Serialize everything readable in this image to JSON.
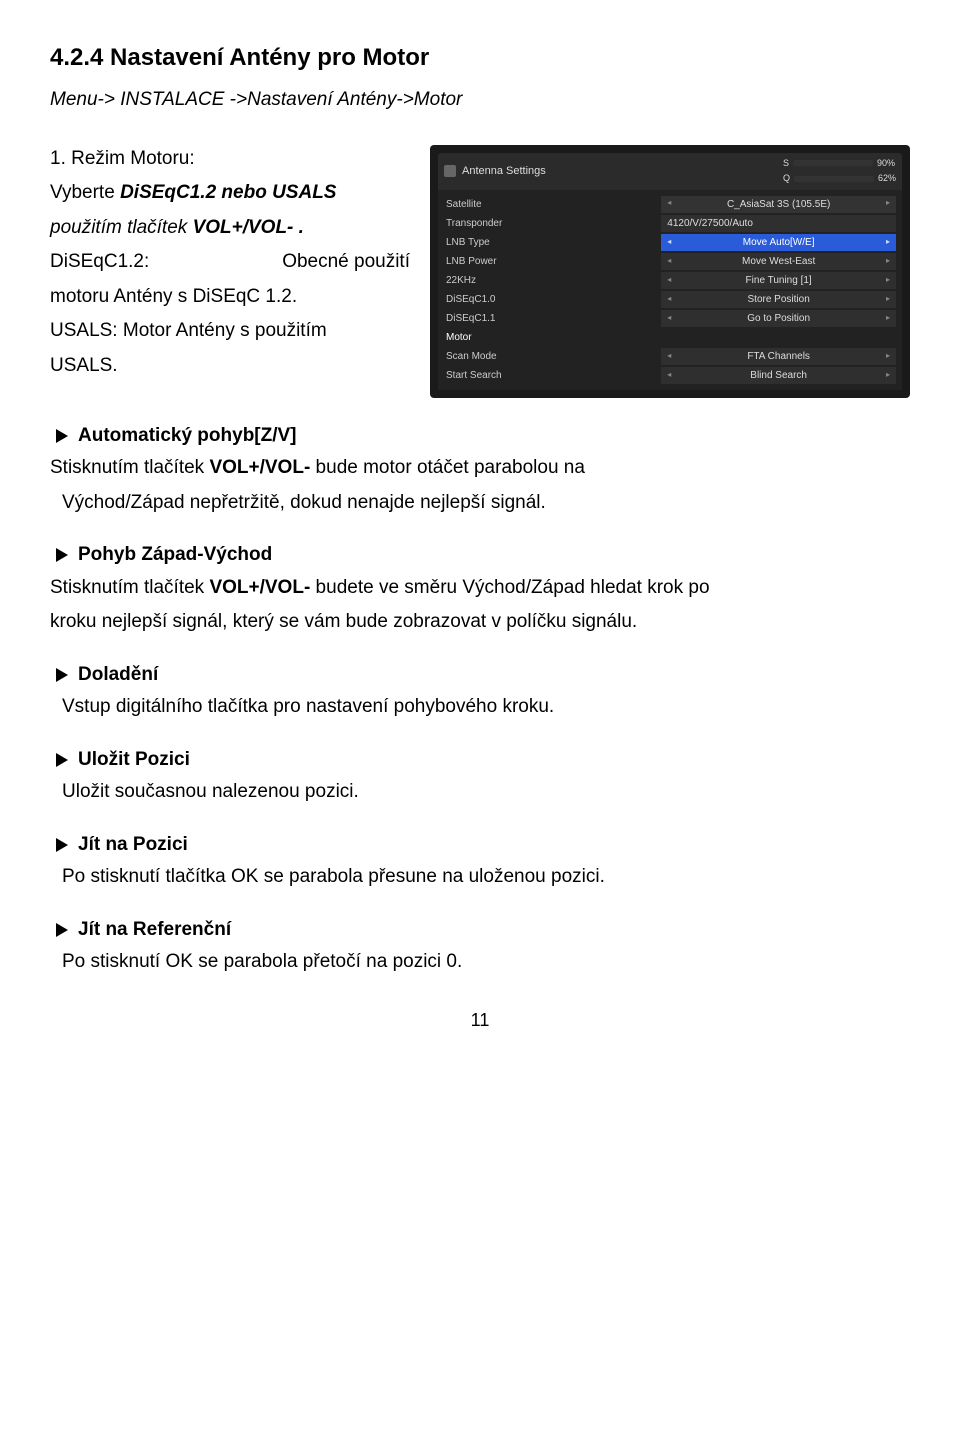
{
  "title": "4.2.4 Nastavení Antény pro Motor",
  "breadcrumb": "Menu-> INSTALACE ->Nastavení Antény->Motor",
  "intro": {
    "line1_label": "1. Režim Motoru:",
    "line2a": "Vyberte ",
    "line2b": "DiSEqC1.2 nebo USALS",
    "line3a": "použitím tlačítek ",
    "line3b": "VOL+/VOL- .",
    "line4a": "DiSEqC1.2:",
    "line4b": "Obecné použití",
    "line5": "motoru Antény s DiSEqC 1.2.",
    "line6": "USALS: Motor Antény s použitím",
    "line7": "USALS."
  },
  "screenshot": {
    "tab_title": "Antenna Settings",
    "s_label": "S",
    "s_pct": "90%",
    "s_fill": 90,
    "q_label": "Q",
    "q_pct": "62%",
    "q_fill": 62,
    "left_labels": [
      "Satellite",
      "Transponder",
      "LNB Type",
      "LNB Power",
      "22KHz",
      "DiSEqC1.0",
      "DiSEqC1.1",
      "Motor",
      "Scan Mode",
      "Start Search"
    ],
    "sat_value": "C_AsiaSat 3S (105.5E)",
    "tp_value": "4120/V/27500/Auto",
    "right_values": [
      "Move Auto[W/E]",
      "Move West-East",
      "Fine Tuning [1]",
      "Store Position",
      "Go to Position",
      "",
      "FTA Channels",
      "Blind Search"
    ],
    "selected_right_index": 0
  },
  "sections": [
    {
      "heading": "Automatický pohyb[Z/V]",
      "body": [
        {
          "plain_before": "Stisknutím tlačítek ",
          "bold": "VOL+/VOL-",
          "plain_after": "  bude motor otáčet parabolou na"
        },
        {
          "indent_plain": "Východ/Západ  nepřetržitě, dokud nenajde nejlepší signál."
        }
      ]
    },
    {
      "heading": "Pohyb Západ-Východ",
      "body": [
        {
          "plain_before": "Stisknutím tlačítek ",
          "bold": "VOL+/VOL-",
          "plain_after": " budete ve směru Východ/Západ  hledat krok po"
        },
        {
          "plain": "kroku nejlepší signál, který se vám bude zobrazovat v políčku signálu."
        }
      ]
    },
    {
      "heading": "Doladění",
      "body": [
        {
          "indent_plain": "Vstup digitálního tlačítka pro nastavení pohybového kroku."
        }
      ]
    },
    {
      "heading": "Uložit Pozici",
      "body": [
        {
          "indent_plain": "Uložit současnou nalezenou pozici."
        }
      ]
    },
    {
      "heading": "Jít na Pozici",
      "body": [
        {
          "indent_plain": "Po stisknutí tlačítka OK se parabola přesune na uloženou pozici."
        }
      ]
    },
    {
      "heading": "Jít na Referenční",
      "body": [
        {
          "indent_plain": "Po stisknutí OK se parabola přetočí na pozici 0."
        }
      ]
    }
  ],
  "page_number": "11"
}
